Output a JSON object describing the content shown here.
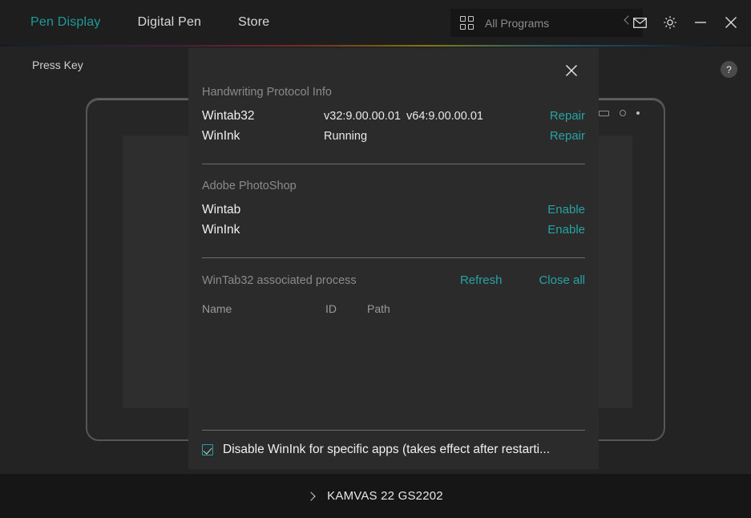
{
  "titlebar": {
    "nav": [
      {
        "label": "Pen Display",
        "active": true
      },
      {
        "label": "Digital Pen",
        "active": false
      },
      {
        "label": "Store",
        "active": false
      }
    ],
    "search": {
      "label": "All Programs",
      "grid_icon": "grid-icon",
      "collapse_icon": "chevron-left-icon"
    },
    "window_buttons": [
      {
        "name": "mail-icon"
      },
      {
        "name": "gear-icon"
      },
      {
        "name": "minimize-icon"
      },
      {
        "name": "close-icon"
      }
    ]
  },
  "stage": {
    "press_key_label": "Press Key",
    "help_label": "?"
  },
  "dialog": {
    "close_icon": "close-icon",
    "section1": {
      "title": "Handwriting Protocol Info",
      "rows": [
        {
          "name": "Wintab32",
          "value": "v32:9.00.00.01",
          "value2": "v64:9.00.00.01",
          "action": "Repair"
        },
        {
          "name": "WinInk",
          "value": "Running",
          "value2": "",
          "action": "Repair"
        }
      ]
    },
    "section2": {
      "title": "Adobe PhotoShop",
      "rows": [
        {
          "name": "Wintab",
          "value": "",
          "value2": "",
          "action": "Enable"
        },
        {
          "name": "WinInk",
          "value": "",
          "value2": "",
          "action": "Enable"
        }
      ]
    },
    "section3": {
      "title": "WinTab32 associated process",
      "refresh_label": "Refresh",
      "close_all_label": "Close all",
      "columns": [
        "Name",
        "ID",
        "Path"
      ],
      "rows": []
    },
    "checkbox": {
      "checked": true,
      "label": "Disable WinInk for specific apps (takes effect after restarti..."
    }
  },
  "bottombar": {
    "device_name": "KAMVAS 22 GS2202",
    "expand_icon": "chevron-right-icon"
  },
  "colors": {
    "accent_teal": "#27a3a3",
    "active_nav": "#1f9a9a",
    "dialog_bg": "#2b2b2b",
    "stage_bg": "#232323",
    "titlebar_bg": "#1e1e1e",
    "bottombar_bg": "#161616"
  }
}
